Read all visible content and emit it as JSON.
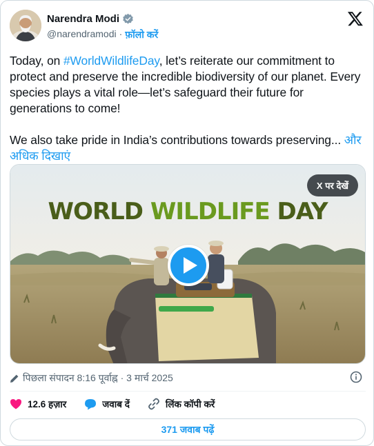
{
  "author": {
    "name": "Narendra Modi",
    "handle": "@narendramodi",
    "separator": "·",
    "follow_label": "फ़ॉलो करें"
  },
  "tweet": {
    "line1_prefix": "Today, on ",
    "hashtag": "#WorldWildlifeDay",
    "line1_suffix": ", let’s reiterate our commitment to protect and preserve the incredible biodiversity of our planet. Every species plays a vital role—let’s safeguard their future for generations to come!",
    "para2": "We also take pride in India’s contributions towards preserving... ",
    "show_more": "और अधिक दिखाएं"
  },
  "media": {
    "title_word1": "WORLD",
    "title_word2": "WILDLIFE",
    "title_word3": "DAY",
    "view_on_x_label": "X पर देखें"
  },
  "meta": {
    "edited_text": "पिछला संपादन 8:16 पूर्वाह्न · 3 मार्च 2025"
  },
  "actions": {
    "likes": "12.6 हज़ार",
    "reply_label": "जवाब दें",
    "copy_link_label": "लिंक कॉपी करें"
  },
  "read_replies_label": "371 जवाब पढ़ें",
  "colors": {
    "accent": "#1d9bf0",
    "like": "#f91880",
    "text_secondary": "#536471"
  }
}
